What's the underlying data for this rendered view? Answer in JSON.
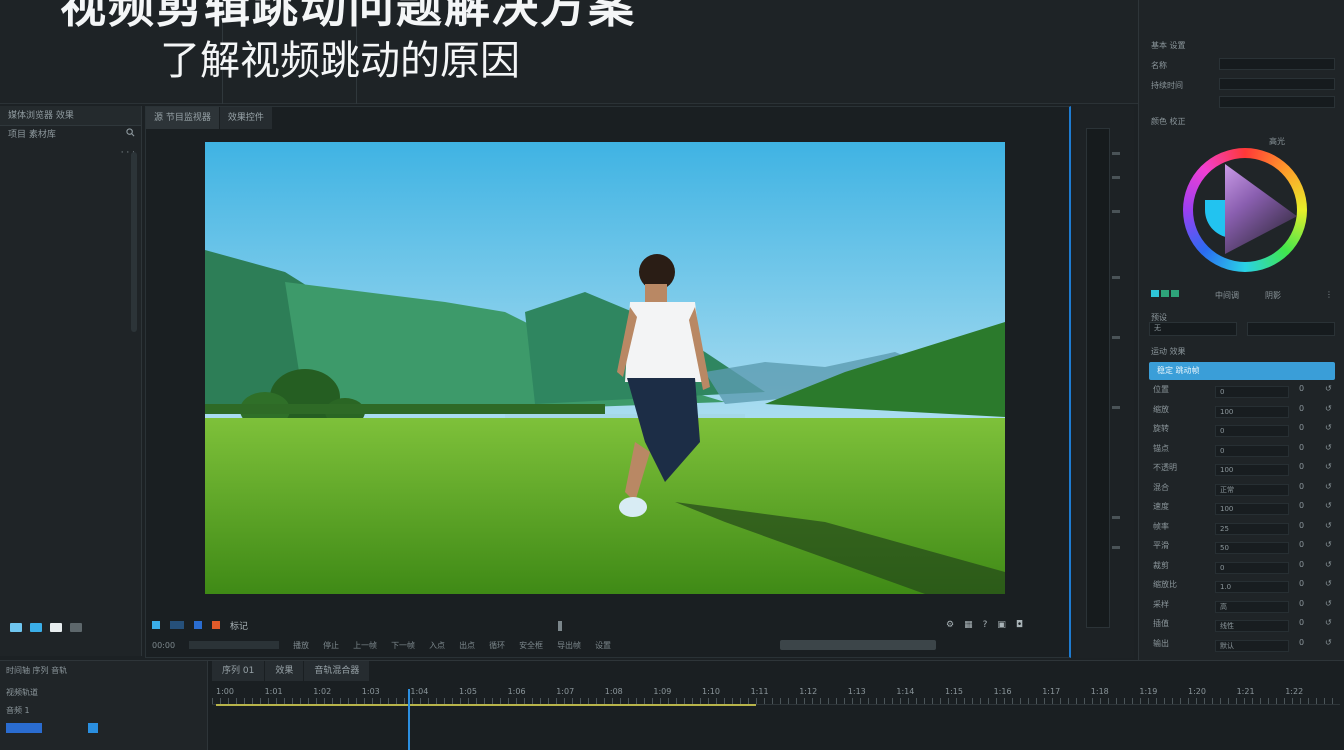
{
  "header": {
    "title": "视频剪辑跳动问题解决方案",
    "subtitle": "了解视频跳动的原因"
  },
  "left_panel": {
    "tab": "媒体浏览器 效果",
    "row1_label": "项目 素材库",
    "row1_icon": "search-icon",
    "swatch_colors": [
      "#6fc6f0",
      "#3aaee8",
      "#e8eef0",
      "#5d676b"
    ]
  },
  "viewer": {
    "tabs": [
      "源 节目监视器",
      "效果控件"
    ],
    "controls_left": "00:00",
    "controls_marker": "标记",
    "controls_row2": [
      "播放",
      "停止",
      "上一帧",
      "下一帧",
      "入点",
      "出点",
      "循环",
      "安全框",
      "导出帧",
      "设置"
    ],
    "accent_color": "#1e7bd0"
  },
  "right_panel": {
    "section1_label": "基本 设置",
    "field1_label": "名称",
    "field2_label": "持续时间",
    "section2_label": "颜色 校正",
    "wheel_caption_top": "高光",
    "wheel_row_labels": [
      "中间调",
      "阴影"
    ],
    "section3_label": "预设",
    "section3_value": "无",
    "section4_label": "运动 效果",
    "highlight_item": "稳定 跳动帧",
    "rows": [
      {
        "k": "位置",
        "v": "0",
        "e": "0"
      },
      {
        "k": "缩放",
        "v": "100",
        "e": "0"
      },
      {
        "k": "旋转",
        "v": "0",
        "e": "0"
      },
      {
        "k": "锚点",
        "v": "0",
        "e": "0"
      },
      {
        "k": "不透明",
        "v": "100",
        "e": "0"
      },
      {
        "k": "混合",
        "v": "正常",
        "e": "0"
      },
      {
        "k": "速度",
        "v": "100",
        "e": "0"
      },
      {
        "k": "帧率",
        "v": "25",
        "e": "0"
      },
      {
        "k": "平滑",
        "v": "50",
        "e": "0"
      },
      {
        "k": "裁剪",
        "v": "0",
        "e": "0"
      },
      {
        "k": "缩放比",
        "v": "1.0",
        "e": "0"
      },
      {
        "k": "采样",
        "v": "高",
        "e": "0"
      },
      {
        "k": "插值",
        "v": "线性",
        "e": "0"
      },
      {
        "k": "输出",
        "v": "默认",
        "e": "0"
      }
    ]
  },
  "timeline": {
    "left_tab": "时间轴 序列 音轨",
    "left_rows": [
      "视频轨道",
      "音频 1"
    ],
    "tabs": [
      "序列 01",
      "效果",
      "音轨混合器"
    ],
    "ruler_labels": [
      "1:00",
      "1:01",
      "1:02",
      "1:03",
      "1:04",
      "1:05",
      "1:06",
      "1:07",
      "1:08",
      "1:09",
      "1:10",
      "1:11",
      "1:12",
      "1:13",
      "1:14",
      "1:15",
      "1:16",
      "1:17",
      "1:18",
      "1:19",
      "1:20",
      "1:21",
      "1:22"
    ],
    "playhead_color": "#2b8fe0"
  }
}
